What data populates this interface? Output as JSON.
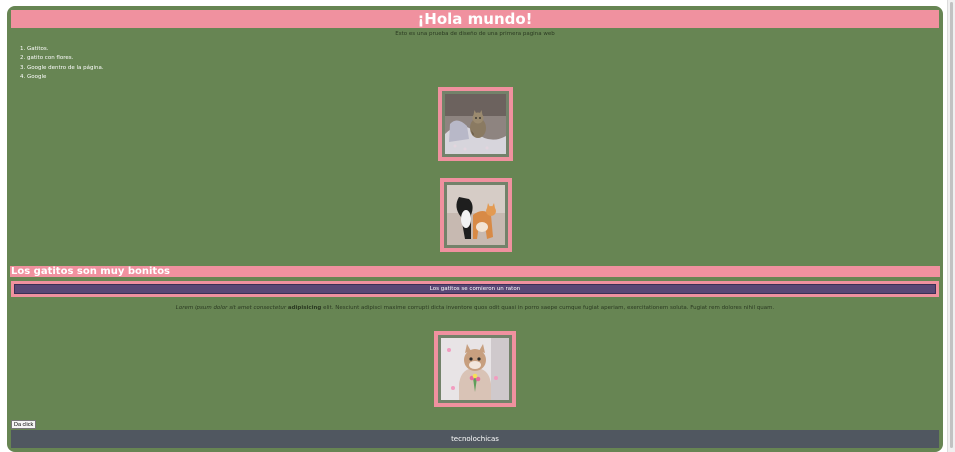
{
  "page": {
    "title": "¡Hola mundo!",
    "subtitle": "Esto es una prueba de diseño de una primera pagina web",
    "list": [
      "1. Gatitos.",
      "2. gatito con flores.",
      "3. Google dentro de la página.",
      "4. Google"
    ],
    "section_heading": "Los gatitos son muy bonitos",
    "event_text": "Los gatitos se comieron un raton",
    "lorem": {
      "part1": "Lorem ipsum dolor sit amet consectetur ",
      "bold": "adipisicing",
      "part2": " elit. Nesciunt adipisci maxime corrupti dicta inventore quos odit quasi in porro saepe cumque fugiat aperiam, exercitationem soluta. Fugiat rem dolores nihil quam."
    },
    "button_label": "Da click",
    "footer_text": "tecnolochicas"
  },
  "images": [
    {
      "name": "kitten-on-bed"
    },
    {
      "name": "two-cats"
    },
    {
      "name": "kitten-with-flowers"
    }
  ],
  "colors": {
    "background": "#678553",
    "accent_pink": "#f0919f",
    "event_purple": "#5a4776",
    "footer": "#505760"
  }
}
